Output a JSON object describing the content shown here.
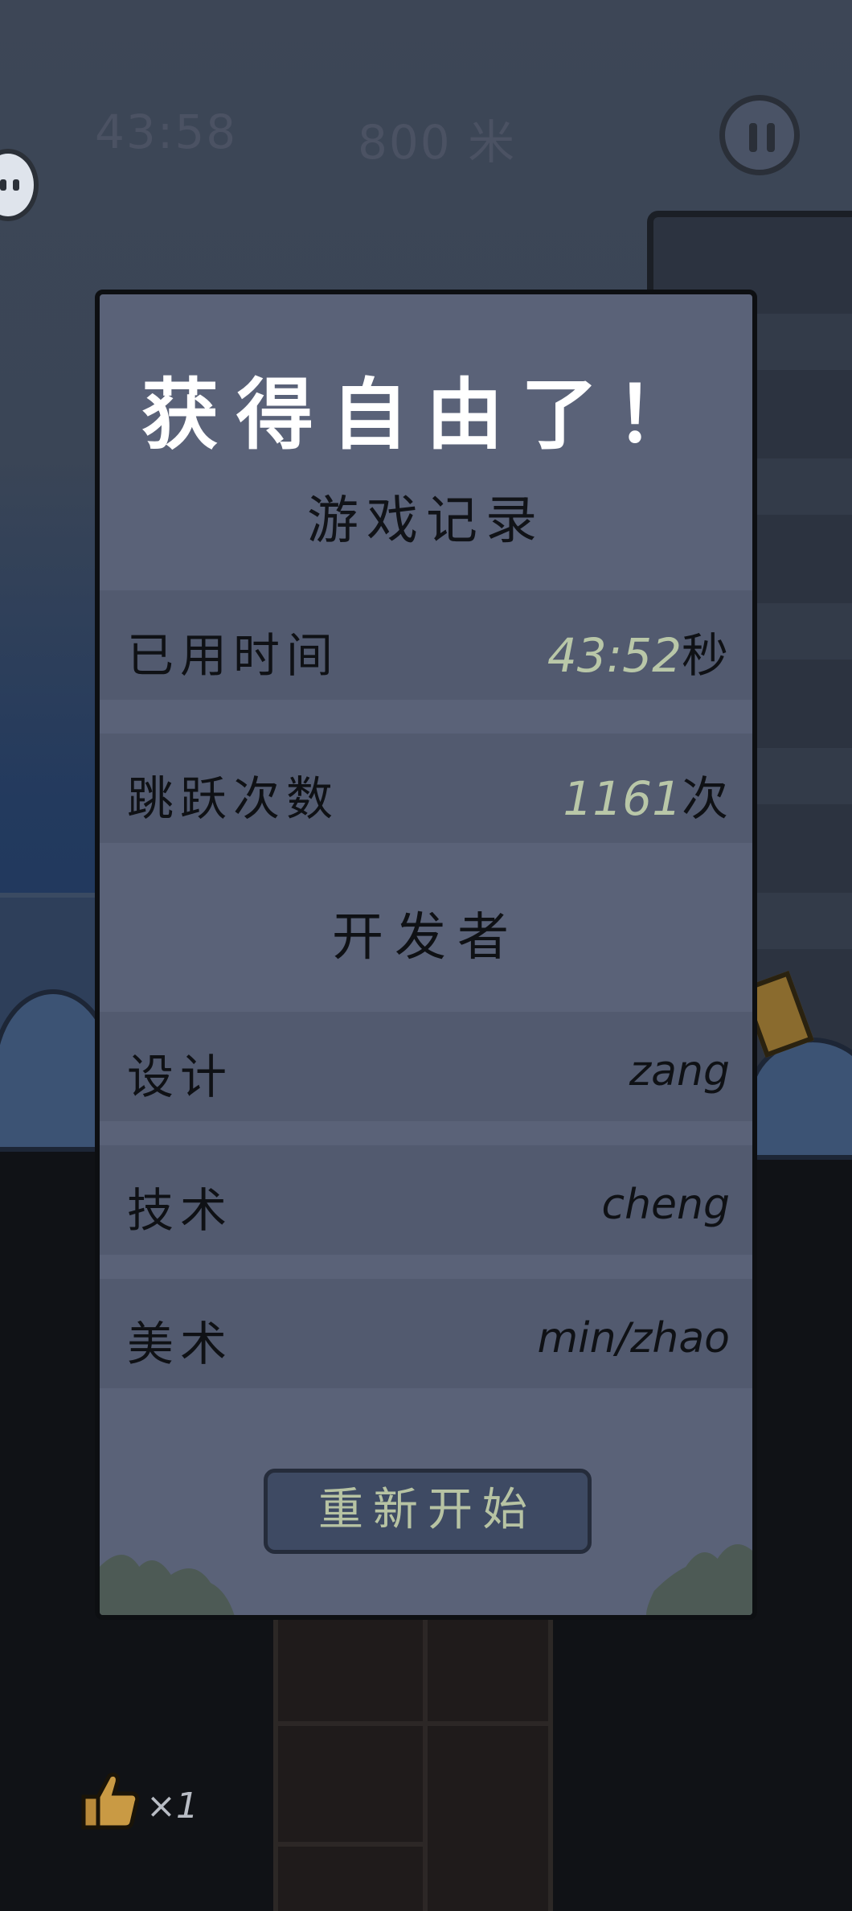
{
  "hud": {
    "time": "43:58",
    "distance": "800 米"
  },
  "dialog": {
    "title": "获得自由了！",
    "subtitle": "游戏记录",
    "stats": [
      {
        "label": "已用时间",
        "value": "43:52",
        "unit": "秒"
      },
      {
        "label": "跳跃次数",
        "value": "1161",
        "unit": "次"
      }
    ],
    "developers_title": "开发者",
    "credits": [
      {
        "role": "设计",
        "name": "zang"
      },
      {
        "role": "技术",
        "name": "cheng"
      },
      {
        "role": "美术",
        "name": "min/zhao"
      }
    ],
    "restart_label": "重新开始"
  },
  "inventory": {
    "count": "×1"
  },
  "colors": {
    "dialog_bg": "#5a6278",
    "row_bg": "#525a6f",
    "accent_number": "#b9c7a8",
    "button_bg": "#3e4a63"
  }
}
